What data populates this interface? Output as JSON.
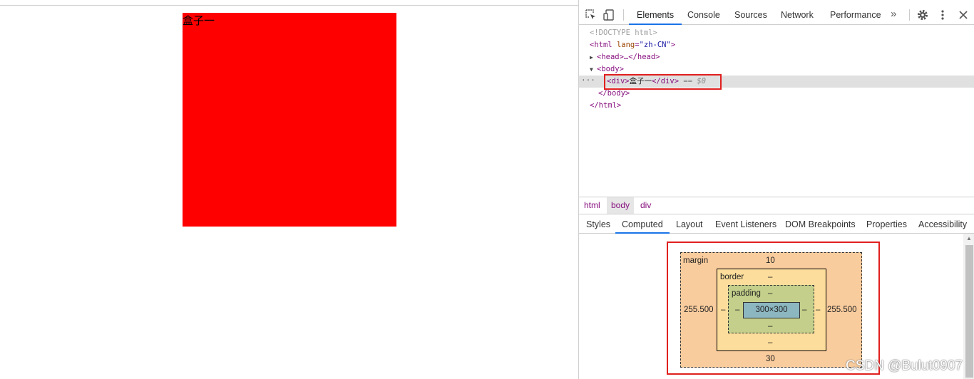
{
  "page": {
    "box_text": "盒子一",
    "box_color": "#ff0000"
  },
  "devtools": {
    "toolbar": {
      "icons": [
        "inspect-icon",
        "device-toggle-icon",
        "settings-icon",
        "more-vert-icon",
        "close-icon"
      ],
      "tabs": [
        "Elements",
        "Console",
        "Sources",
        "Network",
        "Performance"
      ],
      "active_tab": "Elements",
      "overflow": "»"
    },
    "dom": {
      "doctype": "<!DOCTYPE html>",
      "html_open": "<html",
      "lang_attr": "lang",
      "lang_value": "\"zh-CN\"",
      "gt": ">",
      "head": "<head>…</head>",
      "body_open": "<body>",
      "div_open": "<div>",
      "div_text": "盒子一",
      "div_close": "</div>",
      "selected_marker": "== $0",
      "dots": "···",
      "body_close": "</body>",
      "html_close": "</html>"
    },
    "breadcrumbs": [
      "html",
      "body",
      "div"
    ],
    "panel_tabs": [
      "Styles",
      "Computed",
      "Layout",
      "Event Listeners",
      "DOM Breakpoints",
      "Properties",
      "Accessibility"
    ],
    "active_panel_tab": "Computed",
    "box_model": {
      "margin_label": "margin",
      "margin_top": "10",
      "margin_bottom": "30",
      "margin_left": "255.500",
      "margin_right": "255.500",
      "border_label": "border",
      "border_top": "–",
      "border_bottom": "–",
      "border_left": "–",
      "border_right": "–",
      "padding_label": "padding",
      "padding_top": "–",
      "padding_bottom": "–",
      "padding_left": "–",
      "padding_right": "–",
      "content": "300×300"
    }
  },
  "watermark": "CSDN @Bulut0907",
  "colors": {
    "highlight_frame": "#e0201f",
    "active_tab_underline": "#1a73e8",
    "margin": "#f9cc9d",
    "border": "#fddd9b",
    "padding": "#c3cf8a",
    "content": "#8cb6c0"
  }
}
